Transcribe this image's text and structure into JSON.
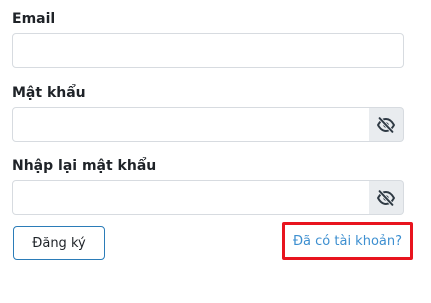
{
  "form": {
    "email_label": "Email",
    "email_value": "",
    "password_label": "Mật khẩu",
    "password_value": "",
    "confirm_label": "Nhập lại mật khẩu",
    "confirm_value": "",
    "eye_icon": "eye-slash-icon",
    "register_label": "Đăng ký",
    "login_link_label": "Đã có tài khoản?"
  },
  "colors": {
    "highlight_border": "#e8141e",
    "link": "#3d8fd0",
    "button_border": "#2b7cb8"
  }
}
